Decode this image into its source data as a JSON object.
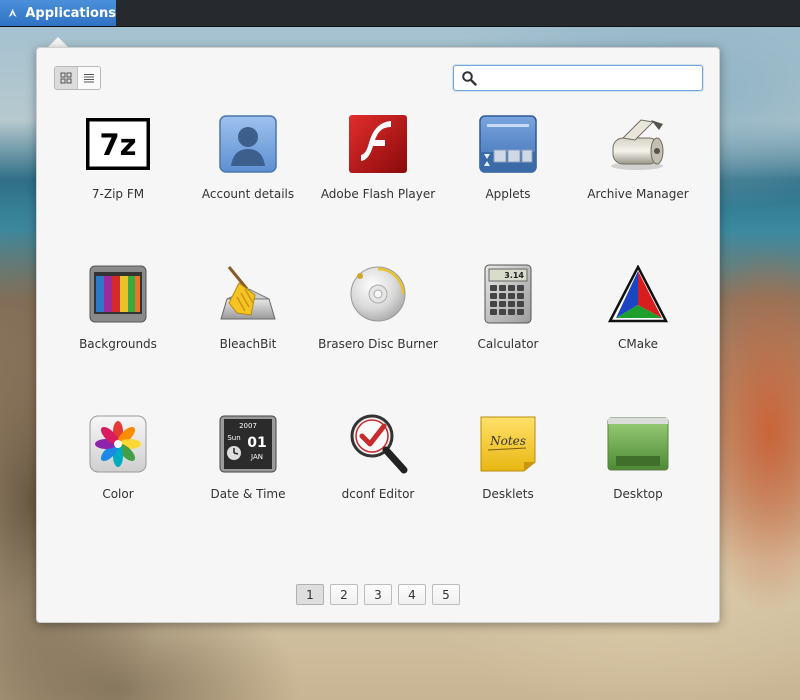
{
  "topbar": {
    "applications_label": "Applications"
  },
  "view_switch": {
    "grid_view": "grid-view-icon",
    "list_view": "list-view-icon"
  },
  "search": {
    "value": "",
    "placeholder": ""
  },
  "apps": [
    {
      "label": "7-Zip FM",
      "icon": "7zip-icon"
    },
    {
      "label": "Account details",
      "icon": "account-details-icon"
    },
    {
      "label": "Adobe Flash Player",
      "icon": "flash-player-icon"
    },
    {
      "label": "Applets",
      "icon": "applets-icon"
    },
    {
      "label": "Archive Manager",
      "icon": "archive-manager-icon"
    },
    {
      "label": "Backgrounds",
      "icon": "backgrounds-icon"
    },
    {
      "label": "BleachBit",
      "icon": "bleachbit-icon"
    },
    {
      "label": "Brasero Disc Burner",
      "icon": "brasero-icon"
    },
    {
      "label": "Calculator",
      "icon": "calculator-icon"
    },
    {
      "label": "CMake",
      "icon": "cmake-icon"
    },
    {
      "label": "Color",
      "icon": "color-icon"
    },
    {
      "label": "Date & Time",
      "icon": "date-time-icon"
    },
    {
      "label": "dconf Editor",
      "icon": "dconf-editor-icon"
    },
    {
      "label": "Desklets",
      "icon": "desklets-icon"
    },
    {
      "label": "Desktop",
      "icon": "desktop-icon"
    }
  ],
  "icon_text": {
    "zip": "7z",
    "calc_display": "3.14",
    "date_year": "2007",
    "date_day": "Sun",
    "date_num": "01",
    "date_month": "JAN",
    "notes": "Notes"
  },
  "pagination": {
    "pages": [
      "1",
      "2",
      "3",
      "4",
      "5"
    ],
    "current": "1"
  },
  "colors": {
    "accent": "#3a7fd0",
    "popup_bg": "#f6f6f6",
    "topbar_bg": "#262a2e"
  }
}
